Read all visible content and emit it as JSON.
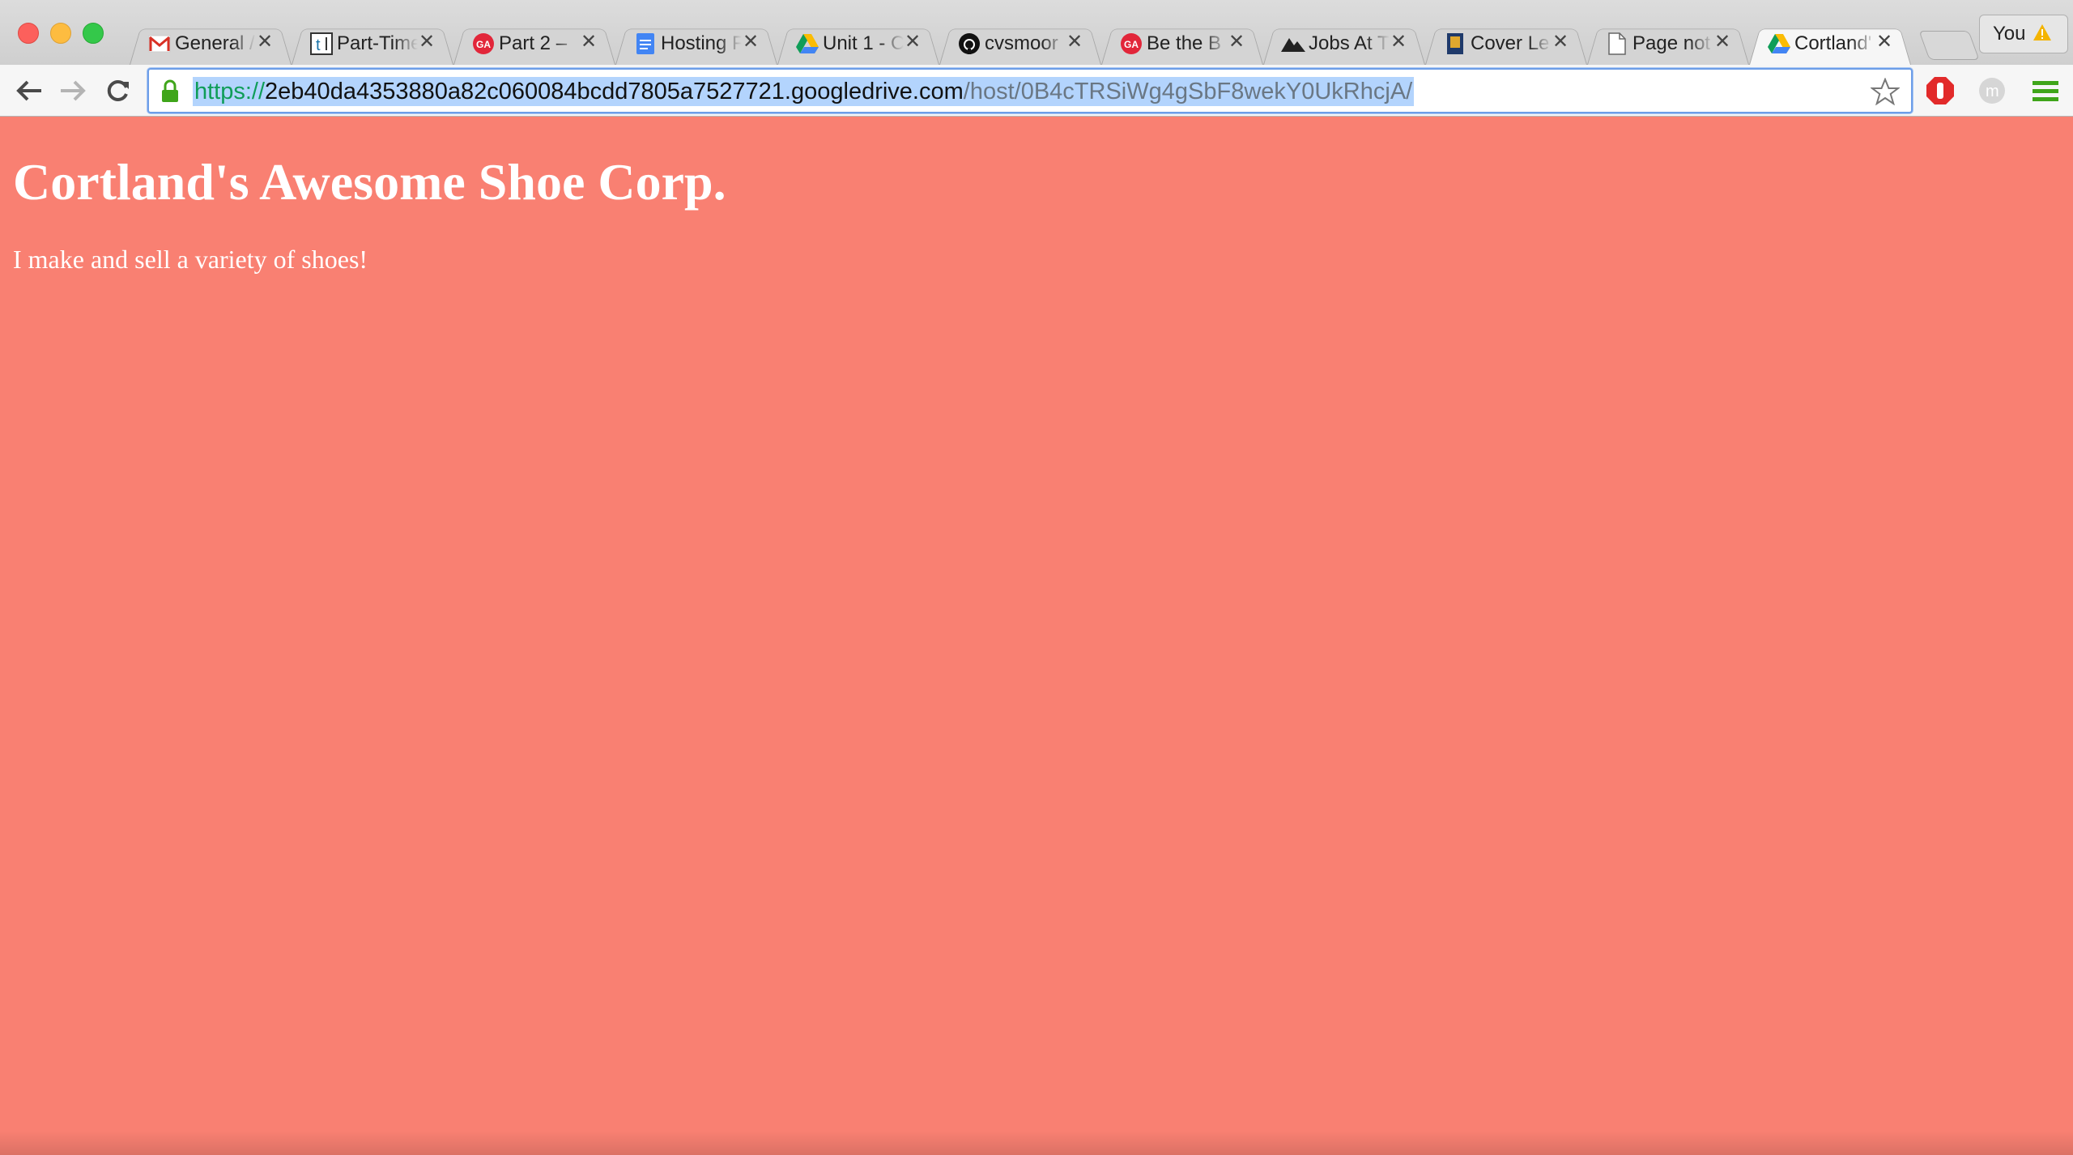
{
  "browser": {
    "tabs": [
      {
        "title": "General /",
        "icon": "gmail-icon",
        "active": false
      },
      {
        "title": "Part-Time",
        "icon": "t-icon",
        "active": false
      },
      {
        "title": "Part 2 –",
        "icon": "ga-icon",
        "active": false
      },
      {
        "title": "Hosting F",
        "icon": "docs-icon",
        "active": false
      },
      {
        "title": "Unit 1 - C",
        "icon": "drive-icon",
        "active": false
      },
      {
        "title": "cvsmoor",
        "icon": "github-icon",
        "active": false
      },
      {
        "title": "Be the B",
        "icon": "ga-icon",
        "active": false
      },
      {
        "title": "Jobs At T",
        "icon": "mountain-icon",
        "active": false
      },
      {
        "title": "Cover Le",
        "icon": "book-icon",
        "active": false
      },
      {
        "title": "Page not",
        "icon": "page-icon",
        "active": false
      },
      {
        "title": "Cortland'",
        "icon": "drive-icon",
        "active": true
      }
    ],
    "profile": {
      "name": "You"
    },
    "address": {
      "scheme": "https://",
      "host": "2eb40da4353880a82c060084bcdd7805a7527721.googledrive.com",
      "path": "/host/0B4cTRSiWg4gSbF8wekY0UkRhcjA/"
    },
    "colors": {
      "page_background": "#f98072",
      "accent": "#6d9ee8"
    }
  },
  "page": {
    "heading": "Cortland's Awesome Shoe Corp.",
    "text": "I make and sell a variety of shoes!"
  }
}
